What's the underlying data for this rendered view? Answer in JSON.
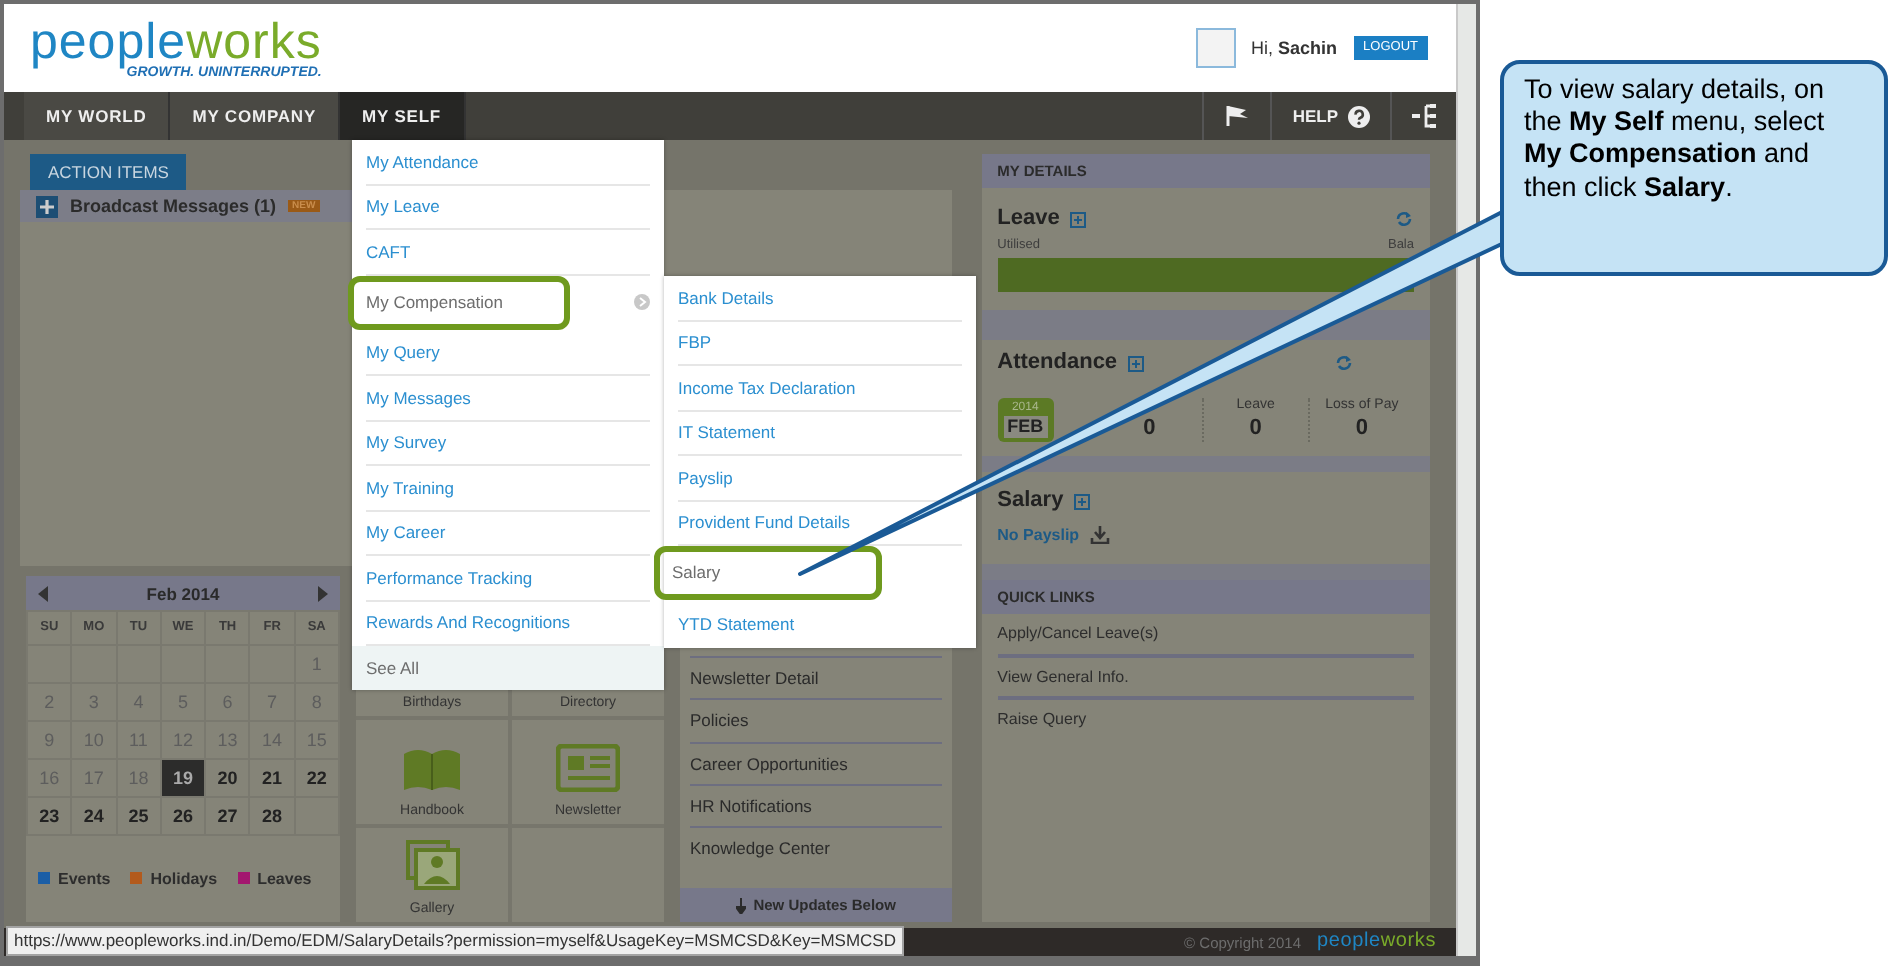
{
  "header": {
    "logo_first": "people",
    "logo_second": "works",
    "tagline": "GROWTH. UNINTERRUPTED.",
    "greeting": "Hi, **Sachin**",
    "logout": "LOGOUT"
  },
  "nav": {
    "items": [
      {
        "label": "MY WORLD",
        "selected": false
      },
      {
        "label": "MY COMPANY",
        "selected": false
      },
      {
        "label": "MY SELF",
        "selected": true
      }
    ],
    "help": "HELP"
  },
  "action_items": {
    "tab": "ACTION ITEMS",
    "broadcast": "Broadcast Messages (1)",
    "badge": "NEW"
  },
  "calendar": {
    "month": "Feb 2014",
    "weekdays": [
      "SU",
      "MO",
      "TU",
      "WE",
      "TH",
      "FR",
      "SA"
    ],
    "weeks": [
      [
        {
          "kind": "blank"
        },
        {
          "kind": "blank"
        },
        {
          "kind": "blank"
        },
        {
          "kind": "blank"
        },
        {
          "kind": "blank"
        },
        {
          "kind": "blank"
        },
        {
          "day": "1",
          "kind": "past"
        }
      ],
      [
        {
          "day": "2",
          "kind": "past"
        },
        {
          "day": "3",
          "kind": "past"
        },
        {
          "day": "4",
          "kind": "past"
        },
        {
          "day": "5",
          "kind": "past"
        },
        {
          "day": "6",
          "kind": "past"
        },
        {
          "day": "7",
          "kind": "past"
        },
        {
          "day": "8",
          "kind": "past"
        }
      ],
      [
        {
          "day": "9",
          "kind": "past"
        },
        {
          "day": "10",
          "kind": "past"
        },
        {
          "day": "11",
          "kind": "past"
        },
        {
          "day": "12",
          "kind": "past"
        },
        {
          "day": "13",
          "kind": "past"
        },
        {
          "day": "14",
          "kind": "past"
        },
        {
          "day": "15",
          "kind": "past"
        }
      ],
      [
        {
          "day": "16",
          "kind": "past"
        },
        {
          "day": "17",
          "kind": "past"
        },
        {
          "day": "18",
          "kind": "past"
        },
        {
          "day": "19",
          "kind": "today"
        },
        {
          "day": "20",
          "kind": "upcoming"
        },
        {
          "day": "21",
          "kind": "upcoming"
        },
        {
          "day": "22",
          "kind": "upcoming"
        }
      ],
      [
        {
          "day": "23",
          "kind": "upcoming"
        },
        {
          "day": "24",
          "kind": "upcoming"
        },
        {
          "day": "25",
          "kind": "upcoming"
        },
        {
          "day": "26",
          "kind": "upcoming"
        },
        {
          "day": "27",
          "kind": "upcoming"
        },
        {
          "day": "28",
          "kind": "upcoming"
        },
        {
          "kind": "blank"
        }
      ]
    ],
    "legend": [
      {
        "label": "Events",
        "color": "#1b5ea6"
      },
      {
        "label": "Holidays",
        "color": "#b35a1c"
      },
      {
        "label": "Leaves",
        "color": "#a3176f"
      }
    ]
  },
  "tiles": [
    {
      "label": "Birthdays",
      "kind": "plain"
    },
    {
      "label": "Directory",
      "kind": "plain"
    },
    {
      "label": "Handbook",
      "kind": "book"
    },
    {
      "label": "Newsletter",
      "kind": "newspaper"
    },
    {
      "label": "Gallery",
      "kind": "gallery"
    }
  ],
  "updates": {
    "items": [
      "Newsletter Detail",
      "Policies",
      "Career Opportunities",
      "HR Notifications",
      "Knowledge Center"
    ],
    "footer": "New Updates Below"
  },
  "my_details": {
    "title": "MY DETAILS",
    "leave": {
      "title": "Leave",
      "utilised": "Utilised",
      "balance": "Bala"
    },
    "attendance": {
      "title": "Attendance",
      "year": "2014",
      "month": "FEB",
      "stats": [
        {
          "value": "0"
        },
        {
          "label": "Leave",
          "value": "0"
        },
        {
          "label": "Loss of Pay",
          "value": "0"
        }
      ]
    },
    "salary": {
      "title": "Salary",
      "link": "No Payslip"
    }
  },
  "quick_links": {
    "title": "QUICK LINKS",
    "items": [
      "Apply/Cancel Leave(s)",
      "View General Info.",
      "Raise Query"
    ]
  },
  "footer": {
    "copyright": "© Copyright 2014",
    "logo_first": "people",
    "logo_second": "works"
  },
  "status_url": "https://www.peopleworks.ind.in/Demo/EDM/SalaryDetails?permission=myself&UsageKey=MSMCSD&Key=MSMCSD",
  "menu": {
    "items": [
      {
        "label": "My Attendance",
        "highlighted": false,
        "submenu": false
      },
      {
        "label": "My Leave",
        "highlighted": false,
        "submenu": false
      },
      {
        "label": "CAFT",
        "highlighted": false,
        "submenu": false
      },
      {
        "label": "My Compensation",
        "highlighted": true,
        "submenu": true
      },
      {
        "label": "My Query",
        "highlighted": false,
        "submenu": false
      },
      {
        "label": "My Messages",
        "highlighted": false,
        "submenu": false
      },
      {
        "label": "My Survey",
        "highlighted": false,
        "submenu": false
      },
      {
        "label": "My Training",
        "highlighted": false,
        "submenu": false
      },
      {
        "label": "My Career",
        "highlighted": false,
        "submenu": false
      },
      {
        "label": "Performance Tracking",
        "highlighted": false,
        "submenu": false
      },
      {
        "label": "Rewards And Recognitions",
        "highlighted": false,
        "submenu": false
      }
    ],
    "see_all": "See All"
  },
  "submenu": {
    "items": [
      {
        "label": "Bank Details",
        "highlighted": false
      },
      {
        "label": "FBP",
        "highlighted": false
      },
      {
        "label": "Income Tax Declaration",
        "highlighted": false
      },
      {
        "label": "IT Statement",
        "highlighted": false
      },
      {
        "label": "Payslip",
        "highlighted": false
      },
      {
        "label": "Provident Fund Details",
        "highlighted": false
      },
      {
        "label": "Salary",
        "highlighted": true
      },
      {
        "label": "YTD Statement",
        "highlighted": false
      }
    ]
  },
  "callout": {
    "text": "To view salary details, on the **My Self** menu, select **My Compensation** and then click **Salary**."
  }
}
